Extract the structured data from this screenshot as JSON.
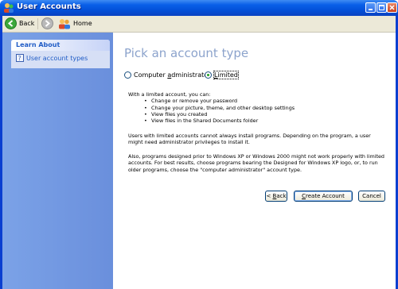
{
  "window": {
    "title": "User Accounts"
  },
  "toolbar": {
    "back_label": "Back",
    "home_label": "Home"
  },
  "sidebar": {
    "header": "Learn About",
    "links": [
      {
        "label": "User account types",
        "icon": "help-icon"
      }
    ]
  },
  "main": {
    "title": "Pick an account type",
    "options": [
      {
        "label": "Computer administrator",
        "access_key": "a",
        "selected": false
      },
      {
        "label": "Limited",
        "access_key": "L",
        "selected": true
      }
    ],
    "intro": "With a limited account, you can:",
    "bullets": [
      "Change or remove your password",
      "Change your picture, theme, and other desktop settings",
      "View files you created",
      "View files in the Shared Documents folder"
    ],
    "para1": "Users with limited accounts cannot always install programs. Depending on the program, a user might need administrator privileges to install it.",
    "para2": "Also, programs designed prior to Windows XP or Windows 2000 might not work properly with limited accounts. For best results, choose programs bearing the Designed for Windows XP logo, or, to run older programs, choose the \"computer administrator\" account type."
  },
  "buttons": {
    "back": "< Back",
    "create": "Create Account",
    "cancel": "Cancel"
  },
  "colors": {
    "titlebar": "#0a5fe8",
    "sidebar": "#7ba2e7",
    "title_text": "#8ca3cc",
    "link": "#215dc6"
  }
}
